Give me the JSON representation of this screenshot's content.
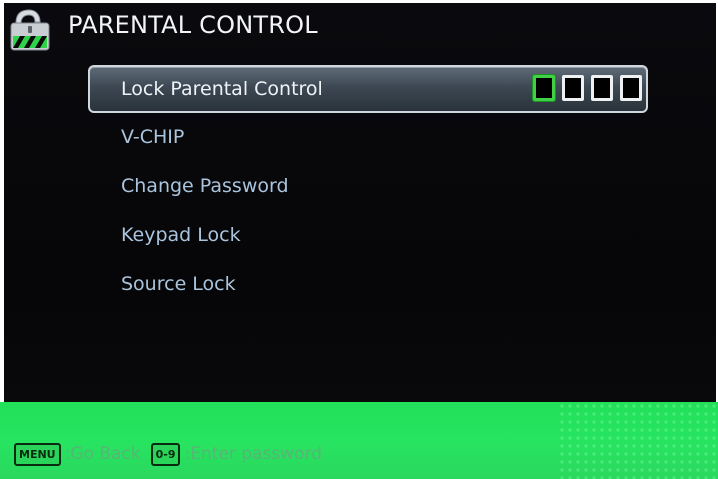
{
  "header": {
    "title": "PARENTAL CONTROL",
    "icon": "lock-icon"
  },
  "menu": {
    "items": [
      {
        "label": "Lock Parental Control",
        "selected": true
      },
      {
        "label": "V-CHIP",
        "selected": false
      },
      {
        "label": "Change Password",
        "selected": false
      },
      {
        "label": "Keypad Lock",
        "selected": false
      },
      {
        "label": "Source Lock",
        "selected": false
      }
    ],
    "pin": {
      "digits": 4,
      "active_index": 0
    }
  },
  "footer": {
    "menu_key": "MENU",
    "menu_hint": ":Go Back",
    "digits_key": "0-9",
    "digits_hint": ":Enter password"
  },
  "colors": {
    "background": "#070709",
    "menu_text": "#a9c4dc",
    "selected_text": "#eef3f8",
    "footer": "#27e460",
    "pin_active_border": "#3fd046"
  }
}
